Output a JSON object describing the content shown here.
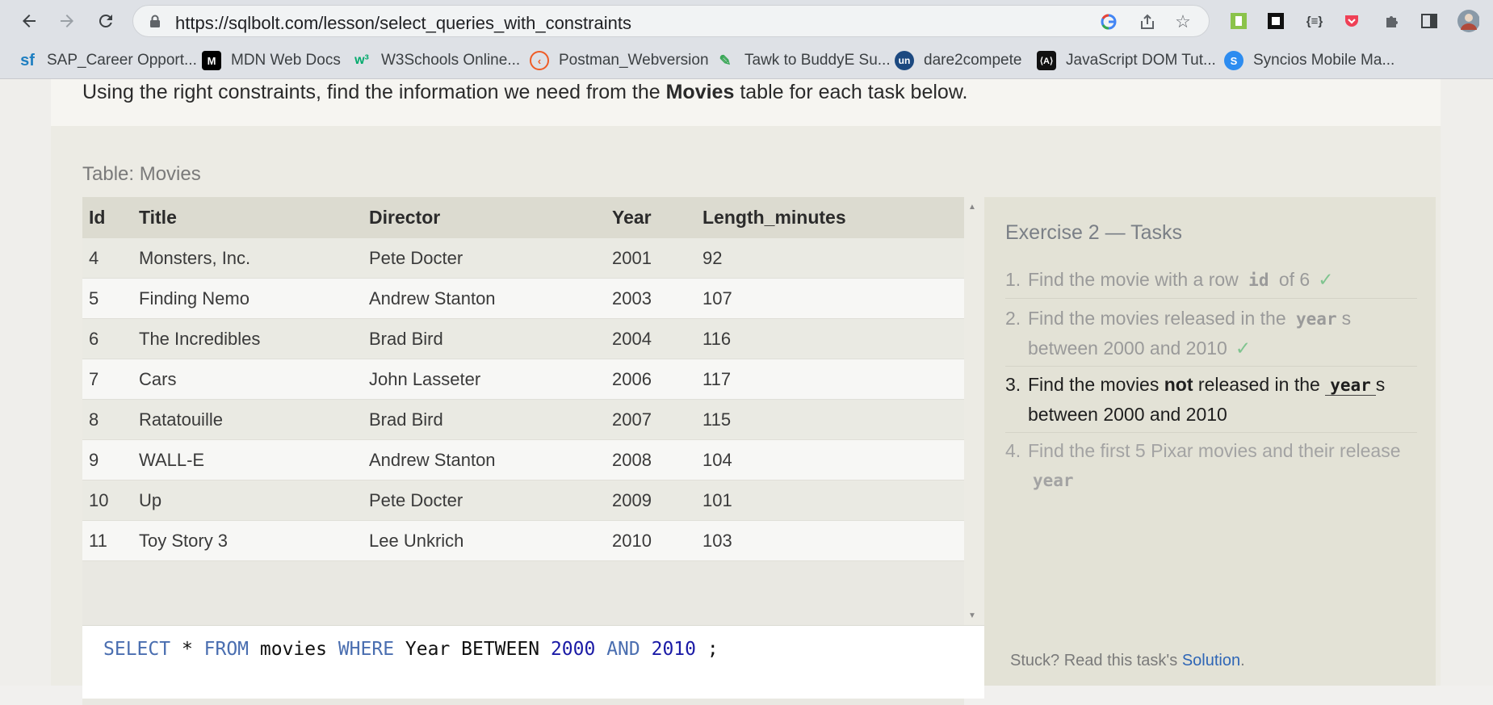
{
  "browser": {
    "url": "https://sqlbolt.com/lesson/select_queries_with_constraints",
    "bookmarks": [
      {
        "label": "SAP_Career Opport...",
        "icon": "sap-icon",
        "color": "#1f7fc1"
      },
      {
        "label": "MDN Web Docs",
        "icon": "mdn-icon",
        "color": "#000000"
      },
      {
        "label": "W3Schools Online...",
        "icon": "w3schools-icon",
        "color": "#04aa6d"
      },
      {
        "label": "Postman_Webversion",
        "icon": "postman-icon",
        "color": "#ef5b25"
      },
      {
        "label": "Tawk to BuddyE Su...",
        "icon": "tawk-icon",
        "color": "#3aa757"
      },
      {
        "label": "dare2compete",
        "icon": "unstop-icon",
        "color": "#1c4980"
      },
      {
        "label": "JavaScript DOM Tut...",
        "icon": "jsdom-icon",
        "color": "#111111"
      },
      {
        "label": "Syncios Mobile Ma...",
        "icon": "syncios-icon",
        "color": "#2d8cf0"
      }
    ]
  },
  "lesson": {
    "intro_pre": "Using the right constraints, find the information we need from the ",
    "intro_bold": "Movies",
    "intro_post": " table for each task below.",
    "table_caption": "Table: Movies",
    "columns": [
      "Id",
      "Title",
      "Director",
      "Year",
      "Length_minutes"
    ],
    "rows": [
      [
        "4",
        "Monsters, Inc.",
        "Pete Docter",
        "2001",
        "92"
      ],
      [
        "5",
        "Finding Nemo",
        "Andrew Stanton",
        "2003",
        "107"
      ],
      [
        "6",
        "The Incredibles",
        "Brad Bird",
        "2004",
        "116"
      ],
      [
        "7",
        "Cars",
        "John Lasseter",
        "2006",
        "117"
      ],
      [
        "8",
        "Ratatouille",
        "Brad Bird",
        "2007",
        "115"
      ],
      [
        "9",
        "WALL-E",
        "Andrew Stanton",
        "2008",
        "104"
      ],
      [
        "10",
        "Up",
        "Pete Docter",
        "2009",
        "101"
      ],
      [
        "11",
        "Toy Story 3",
        "Lee Unkrich",
        "2010",
        "103"
      ]
    ],
    "query": {
      "kw_select": "SELECT",
      "star": " * ",
      "kw_from": "FROM",
      "table": " movies ",
      "kw_where": "WHERE",
      "cond": " Year BETWEEN ",
      "num1": "2000",
      "kw_and": "AND",
      "num2": "2010",
      "end": " ;"
    }
  },
  "tasks": {
    "title": "Exercise 2 — Tasks",
    "t1": {
      "num": "1.",
      "pre": "Find the movie with a row ",
      "code": "id",
      "post": " of 6",
      "check": "✓"
    },
    "t2": {
      "num": "2.",
      "pre": "Find the movies released in the ",
      "code": "year",
      "post": "s",
      "line2": "between 2000 and 2010",
      "check": "✓"
    },
    "t3": {
      "num": "3.",
      "pre": "Find the movies ",
      "bold": "not",
      "mid": " released in the ",
      "code": "year",
      "post": "s",
      "line2": "between 2000 and 2010"
    },
    "t4": {
      "num": "4.",
      "pre": "Find the first 5 Pixar movies and their release",
      "code": "year"
    },
    "stuck_pre": "Stuck? Read this task's ",
    "stuck_link": "Solution",
    "stuck_post": "."
  }
}
